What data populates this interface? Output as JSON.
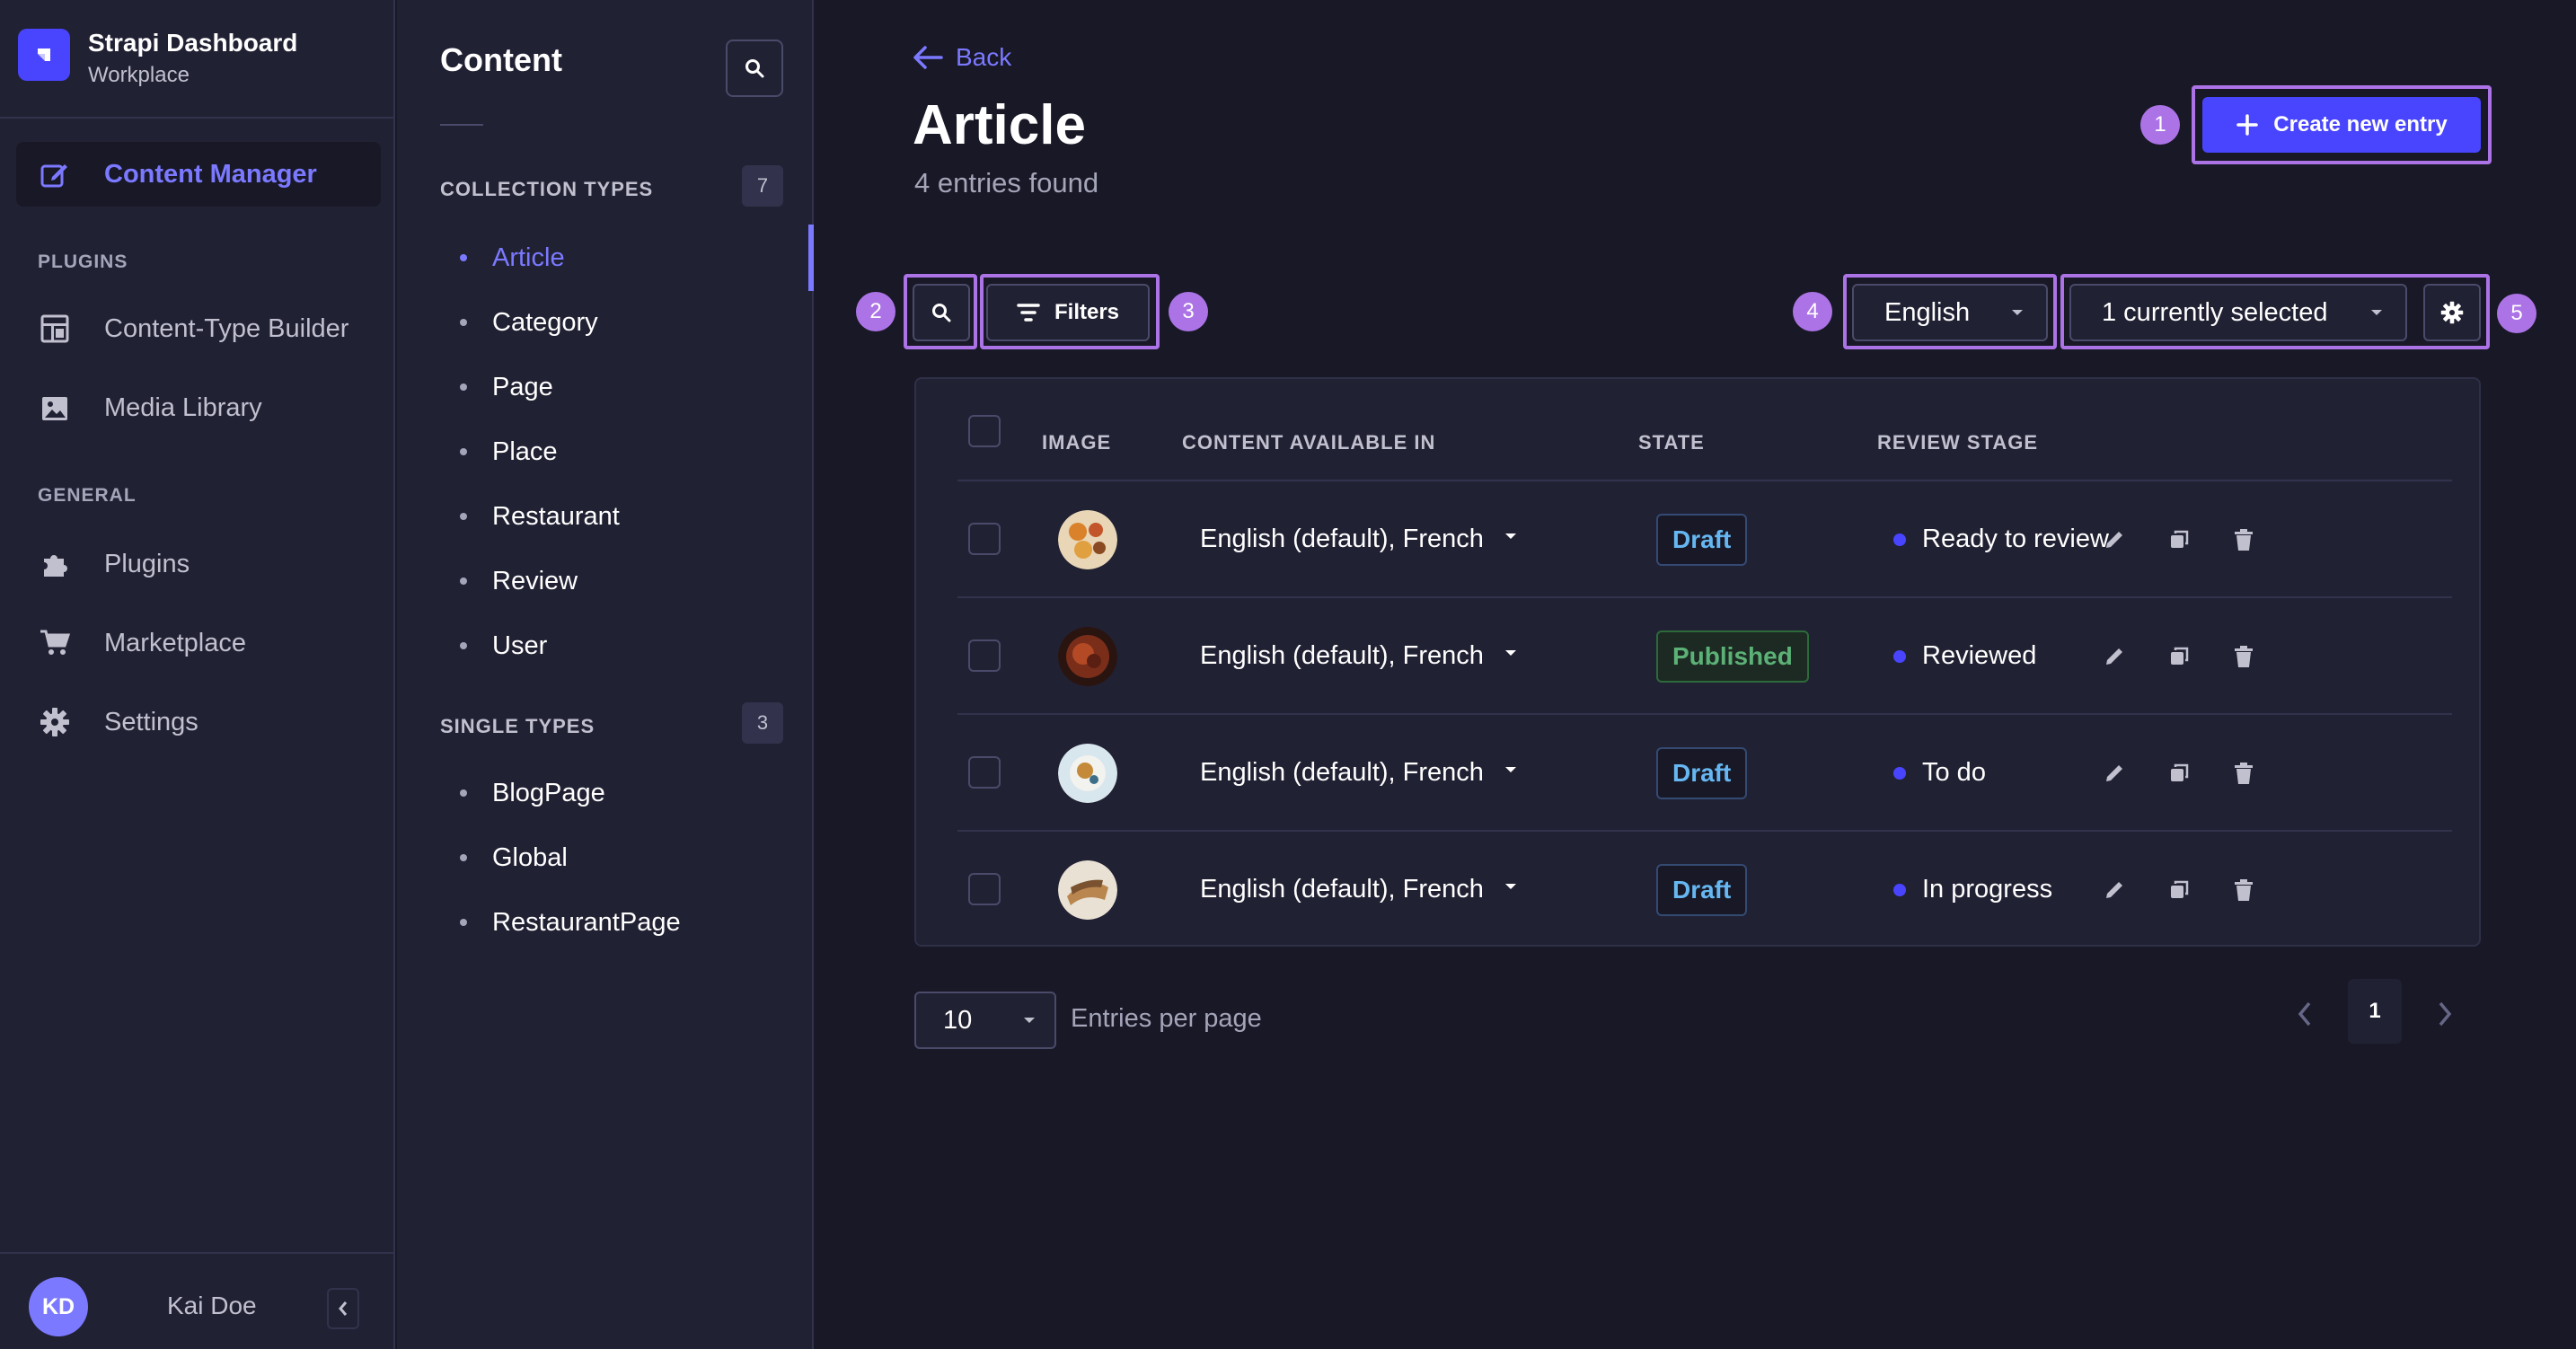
{
  "brand": {
    "title": "Strapi Dashboard",
    "subtitle": "Workplace"
  },
  "mainnav": {
    "active": {
      "label": "Content Manager",
      "icon": "content-manager-icon"
    },
    "plugins_heading": "PLUGINS",
    "plugins": [
      {
        "label": "Content-Type Builder",
        "icon": "layout-icon"
      },
      {
        "label": "Media Library",
        "icon": "image-icon"
      }
    ],
    "general_heading": "GENERAL",
    "general": [
      {
        "label": "Plugins",
        "icon": "puzzle-icon"
      },
      {
        "label": "Marketplace",
        "icon": "cart-icon"
      },
      {
        "label": "Settings",
        "icon": "gear-icon"
      }
    ],
    "user": {
      "initials": "KD",
      "name": "Kai Doe"
    }
  },
  "subnav": {
    "title": "Content",
    "collection_heading": "COLLECTION TYPES",
    "collection_count": "7",
    "collection_types": [
      "Article",
      "Category",
      "Page",
      "Place",
      "Restaurant",
      "Review",
      "User"
    ],
    "active_item": "Article",
    "single_heading": "SINGLE TYPES",
    "single_count": "3",
    "single_types": [
      "BlogPage",
      "Global",
      "RestaurantPage"
    ]
  },
  "header": {
    "back_label": "Back",
    "title": "Article",
    "subtitle": "4 entries found",
    "create_label": "Create new entry"
  },
  "toolbar": {
    "filters_label": "Filters",
    "locale_value": "English",
    "columns_value": "1 currently selected"
  },
  "callouts": [
    "1",
    "2",
    "3",
    "4",
    "5"
  ],
  "table": {
    "columns": [
      "IMAGE",
      "CONTENT AVAILABLE IN",
      "STATE",
      "REVIEW STAGE"
    ],
    "rows": [
      {
        "locales": "English (default), French",
        "state": "Draft",
        "review_stage": "Ready to review"
      },
      {
        "locales": "English (default), French",
        "state": "Published",
        "review_stage": "Reviewed"
      },
      {
        "locales": "English (default), French",
        "state": "Draft",
        "review_stage": "To do"
      },
      {
        "locales": "English (default), French",
        "state": "Draft",
        "review_stage": "In progress"
      }
    ]
  },
  "pagination": {
    "page_size": "10",
    "page_size_label": "Entries per page",
    "current_page": "1"
  },
  "colors": {
    "accent": "#4945ff",
    "accent_text": "#7b79ff",
    "highlight": "#ac73e6",
    "draft": "#66b7f1",
    "published": "#5cb176"
  }
}
